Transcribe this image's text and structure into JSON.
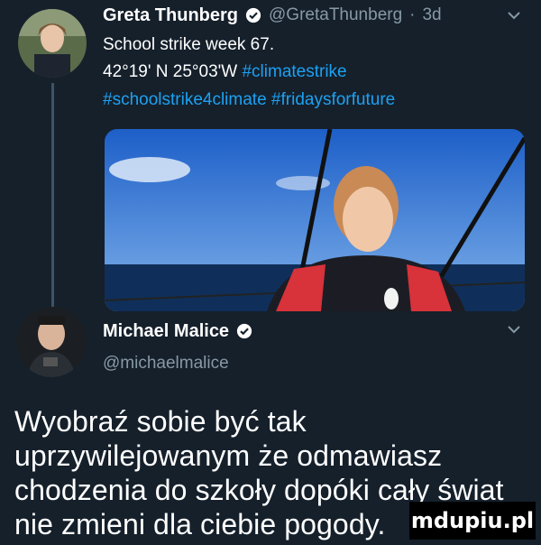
{
  "tweet1": {
    "name": "Greta Thunberg",
    "handle": "@GretaThunberg",
    "time": "3d",
    "line1": "School strike week 67.",
    "line2_plain": "42°19' N 25°03'W",
    "line2_tag": "#climatestrike",
    "line3_tag1": "#schoolstrike4climate",
    "line3_tag2": "#fridaysforfuture"
  },
  "tweet2": {
    "name": "Michael Malice",
    "handle": "@michaelmalice",
    "text_lines": [
      "Wyobraź sobie być tak",
      "uprzywilejowanym że odmawiasz",
      "chodzenia do szkoły dopóki cały świat",
      "nie zmieni dla ciebie pogody."
    ]
  },
  "icons": {
    "verified": "verified-badge-icon",
    "chevron": "chevron-down-icon"
  },
  "colors": {
    "background": "#15202b",
    "link": "#1da1f2",
    "muted": "#8899a6"
  },
  "watermark": "mdupiu.pl"
}
